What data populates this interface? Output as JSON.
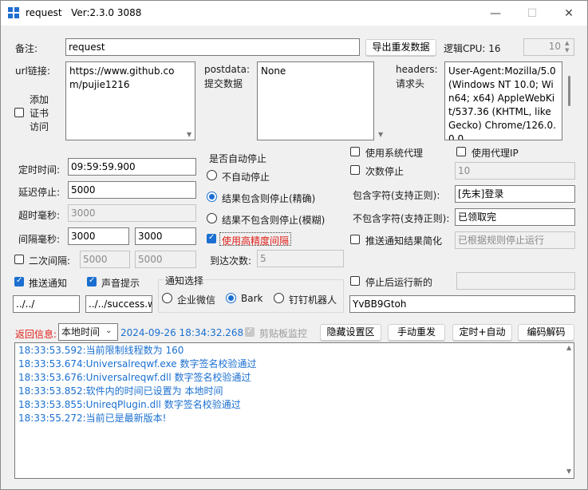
{
  "titlebar": {
    "app_name": "request",
    "version": "Ver:2.3.0 3088",
    "minimize": "—",
    "maximize": "☐",
    "close": "✕"
  },
  "remark": {
    "label": "备注:",
    "value": "request"
  },
  "export_button": "导出重发数据",
  "logic_cpu": {
    "label": "逻辑CPU: 16",
    "thread_value": "10"
  },
  "url": {
    "label": "url链接:",
    "value": "https://www.github.com/pujie1216"
  },
  "cert": {
    "line1": "添加",
    "line2": "证书",
    "line3": "访问",
    "checked": false
  },
  "postdata": {
    "label1": "postdata:",
    "label2": "提交数据",
    "value": "None"
  },
  "headers": {
    "label1": "headers:",
    "label2": "请求头",
    "value": "User-Agent:Mozilla/5.0 (Windows NT 10.0; Win64; x64) AppleWebKit/537.36 (KHTML, like Gecko) Chrome/126.0.0.0"
  },
  "timing": {
    "scheduled_label": "定时时间:",
    "scheduled_value": "09:59:59.900",
    "delay_stop_label": "延迟停止:",
    "delay_stop_value": "5000",
    "timeout_label": "超时毫秒:",
    "timeout_value": "3000",
    "interval_label": "间隔毫秒:",
    "interval_value1": "3000",
    "interval_value2": "3000",
    "second_interval_label": "二次间隔:",
    "second_interval_value1": "5000",
    "second_interval_value2": "5000"
  },
  "auto_stop": {
    "title": "是否自动停止",
    "option_no": "不自动停止",
    "option_contains": "结果包含则停止(精确)",
    "option_not_contains": "结果不包含则停止(模糊)",
    "high_precision": "使用高精度间隔",
    "reach_count_label": "到达次数:",
    "reach_count_value": "5"
  },
  "proxy": {
    "system_proxy": "使用系统代理",
    "proxy_ip": "使用代理IP",
    "count_stop": "次数停止",
    "count_stop_value": "10"
  },
  "match": {
    "contains_label": "包含字符(支持正则):",
    "contains_value": "[先末]登录",
    "not_contains_label": "不包含字符(支持正则):",
    "not_contains_value": "已领取完",
    "push_simplify": "推送通知结果简化",
    "push_simplify_value": "已根据规则停止运行"
  },
  "notify": {
    "push": "推送通知",
    "sound": "声音提示",
    "path1": "../../",
    "path2": "../../success.wav",
    "select_title": "通知选择",
    "wechat": "企业微信",
    "bark": "Bark",
    "dingtalk": "钉钉机器人",
    "stop_run_new": "停止后运行新的",
    "bark_key": "YvBB9Gtoh"
  },
  "toolbar": {
    "return_info": "返回信息:",
    "time_mode": "本地时间",
    "timestamp": "2024-09-26 18:34:32.268",
    "clipboard": "剪贴板监控",
    "hide_settings": "隐藏设置区",
    "manual_resend": "手动重发",
    "timed_auto": "定时+自动",
    "encode_decode": "编码解码"
  },
  "log_lines": [
    "18:33:53.592:当前限制线程数为 160",
    "18:33:53.674:Universalreqwf.exe 数字签名校验通过",
    "18:33:53.676:Universalreqwf.dll 数字签名校验通过",
    "18:33:53.852:软件内的时间已设置为 本地时间",
    "18:33:53.855:UnireqPlugin.dll 数字签名校验通过",
    "18:33:55.272:当前已是最新版本!"
  ]
}
